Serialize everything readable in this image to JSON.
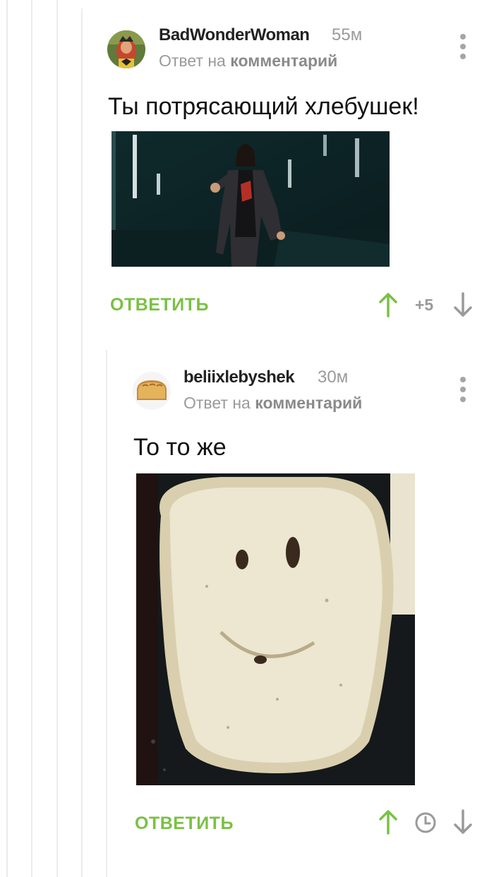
{
  "comments": [
    {
      "username": "BadWonderWoman",
      "time": "55м",
      "reply_prefix": "Ответ на",
      "reply_target": "комментарий",
      "text": "Ты потрясающий хлебушек!",
      "reply_label": "ОТВЕТИТЬ",
      "rating": "+5"
    },
    {
      "username": "beliixlebyshek",
      "time": "30м",
      "reply_prefix": "Ответ на",
      "reply_target": "комментарий",
      "text": "То то же",
      "reply_label": "ОТВЕТИТЬ"
    }
  ],
  "colors": {
    "accent_green": "#7ac143",
    "muted_gray": "#9a9a9a",
    "thread_line": "#ececec"
  }
}
